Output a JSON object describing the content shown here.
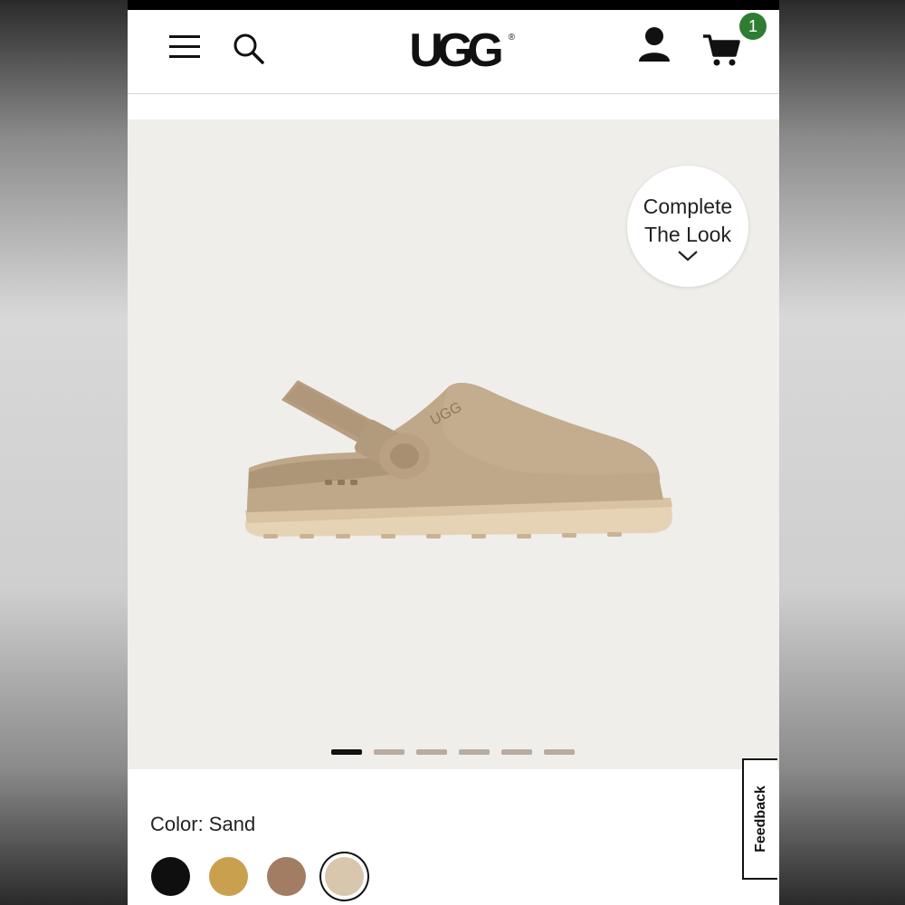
{
  "header": {
    "logo_text": "UGG",
    "logo_mark": "®",
    "cart_count": "1",
    "icons": [
      "menu-icon",
      "search-icon",
      "account-icon",
      "cart-icon"
    ]
  },
  "gallery": {
    "complete_look_line1": "Complete",
    "complete_look_line2": "The Look",
    "complete_look_icon": "chevron-down-icon",
    "pagination_count": 6,
    "active_index": 0
  },
  "product": {
    "color_label": "Color: Sand",
    "swatches": [
      {
        "name": "black",
        "color": "#0f0f0f",
        "selected": false
      },
      {
        "name": "chestnut",
        "color": "#c9a04d",
        "selected": false
      },
      {
        "name": "brown",
        "color": "#a27c63",
        "selected": false
      },
      {
        "name": "sand",
        "color": "#d8c6ad",
        "selected": true
      }
    ]
  },
  "feedback": {
    "label": "Feedback"
  },
  "colors": {
    "accent_badge": "#2f7d32",
    "gallery_bg": "#efeeea",
    "dot_inactive": "#b8aba0",
    "dot_active": "#111111"
  }
}
